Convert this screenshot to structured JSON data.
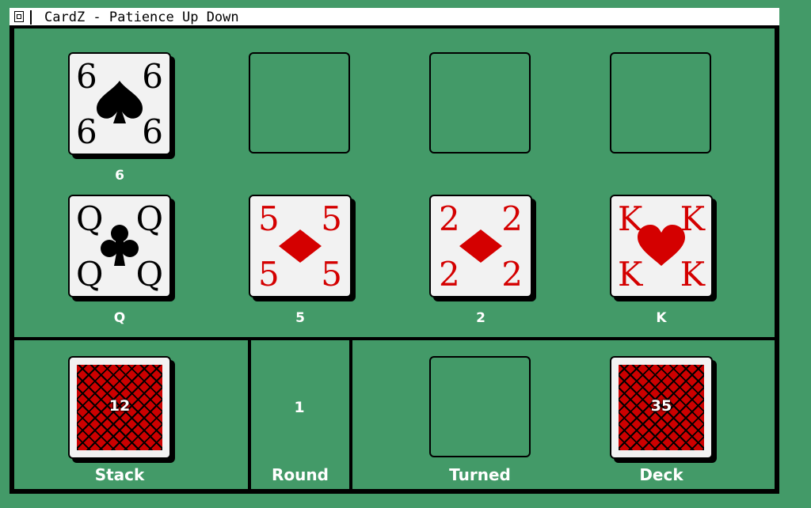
{
  "window": {
    "title": "CardZ - Patience Up Down"
  },
  "tableau": {
    "row1": [
      {
        "rank": "6",
        "suit": "spade",
        "color": "#000000",
        "label": "6"
      },
      null,
      null,
      null
    ],
    "row2": [
      {
        "rank": "Q",
        "suit": "club",
        "color": "#000000",
        "label": "Q"
      },
      {
        "rank": "5",
        "suit": "diamond",
        "color": "#d40000",
        "label": "5"
      },
      {
        "rank": "2",
        "suit": "diamond",
        "color": "#d40000",
        "label": "2"
      },
      {
        "rank": "K",
        "suit": "heart",
        "color": "#d40000",
        "label": "K"
      }
    ]
  },
  "status": {
    "stack": {
      "count": "12",
      "label": "Stack"
    },
    "round": {
      "value": "1",
      "label": "Round"
    },
    "turned": {
      "label": "Turned"
    },
    "deck": {
      "count": "35",
      "label": "Deck"
    }
  },
  "colors": {
    "felt": "#439a68",
    "red": "#d40000",
    "back": "#cc0000"
  }
}
